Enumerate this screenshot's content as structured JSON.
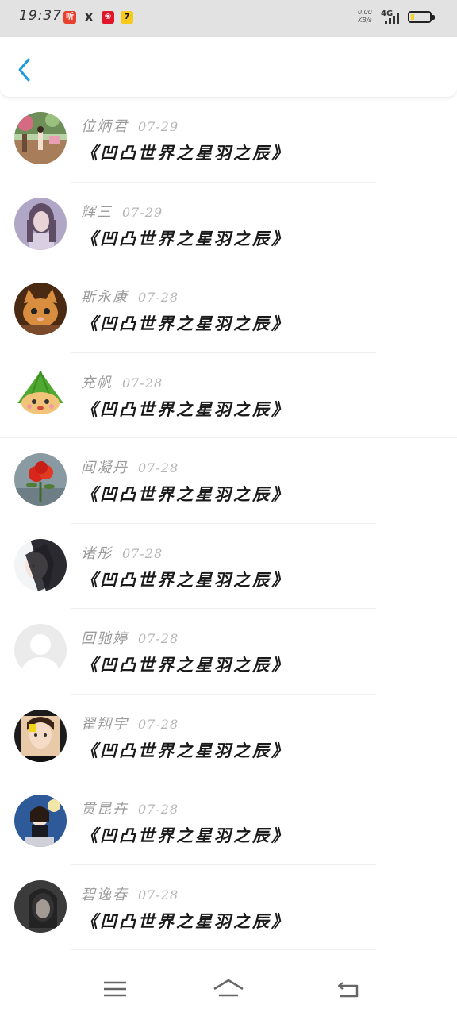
{
  "status_bar": {
    "time": "19:37",
    "apps": [
      {
        "label": "听",
        "icon": "ting-app-icon"
      },
      {
        "label": "X",
        "icon": "x-app-icon"
      },
      {
        "label": "❀",
        "icon": "flower-app-icon"
      },
      {
        "label": "7",
        "icon": "seven-app-icon"
      }
    ],
    "net_speed_value": "0.00",
    "net_speed_unit": "KB/s",
    "network_type": "4G",
    "battery_level": 0.2
  },
  "header": {
    "back_icon": "chevron-left-icon",
    "accent_color": "#1e9be0"
  },
  "list": {
    "items": [
      {
        "name": "位炳君",
        "date": "07-29",
        "title": "《凹凸世界之星羽之辰》",
        "avatar": "avatar-garden"
      },
      {
        "name": "辉三",
        "date": "07-29",
        "title": "《凹凸世界之星羽之辰》",
        "avatar": "avatar-girl-purple"
      },
      {
        "name": "斯永康",
        "date": "07-28",
        "title": "《凹凸世界之星羽之辰》",
        "avatar": "avatar-kitten"
      },
      {
        "name": "充帆",
        "date": "07-28",
        "title": "《凹凸世界之星羽之辰》",
        "avatar": "avatar-zongzi"
      },
      {
        "name": "闻凝丹",
        "date": "07-28",
        "title": "《凹凸世界之星羽之辰》",
        "avatar": "avatar-rose"
      },
      {
        "name": "诸彤",
        "date": "07-28",
        "title": "《凹凸世界之星羽之辰》",
        "avatar": "avatar-girl-dark"
      },
      {
        "name": "回驰婷",
        "date": "07-28",
        "title": "《凹凸世界之星羽之辰》",
        "avatar": "avatar-default"
      },
      {
        "name": "翟翔宇",
        "date": "07-28",
        "title": "《凹凸世界之星羽之辰》",
        "avatar": "avatar-girl-selfie"
      },
      {
        "name": "贯昆卉",
        "date": "07-28",
        "title": "《凹凸世界之星羽之辰》",
        "avatar": "avatar-anime"
      },
      {
        "name": "碧逸春",
        "date": "07-28",
        "title": "《凹凸世界之星羽之辰》",
        "avatar": "avatar-dark-portrait"
      }
    ]
  },
  "bottom_nav": {
    "menu_icon": "menu-icon",
    "home_icon": "home-icon",
    "back_icon": "back-arrow-icon"
  }
}
